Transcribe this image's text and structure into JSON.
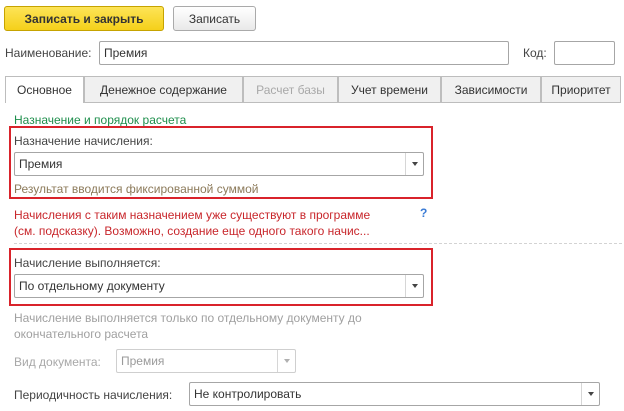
{
  "toolbar": {
    "write_close_label": "Записать и закрыть",
    "write_label": "Записать"
  },
  "header": {
    "name_label": "Наименование:",
    "name_value": "Премия",
    "code_label": "Код:",
    "code_value": ""
  },
  "tabs": [
    {
      "label": "Основное"
    },
    {
      "label": "Денежное содержание"
    },
    {
      "label": "Расчет базы"
    },
    {
      "label": "Учет времени"
    },
    {
      "label": "Зависимости"
    },
    {
      "label": "Приоритет"
    }
  ],
  "main": {
    "section_title": "Назначение и порядок расчета",
    "purpose_label": "Назначение начисления:",
    "purpose_value": "Премия",
    "purpose_hint": "Результат вводится фиксированной суммой",
    "warning_line1": "Начисления с таким назначением уже существуют в программе",
    "warning_line2": "(см. подсказку). Возможно, создание еще одного такого начис...",
    "help_glyph": "?",
    "execution_label": "Начисление выполняется:",
    "execution_value": "По отдельному документу",
    "execution_hint_line1": "Начисление выполняется только по отдельному документу до",
    "execution_hint_line2": "окончательного расчета",
    "doc_type_label": "Вид документа:",
    "doc_type_value": "Премия",
    "periodicity_label": "Периодичность начисления:",
    "periodicity_value": "Не контролировать"
  },
  "colors": {
    "accent_yellow": "#f5d01a",
    "section_green": "#1e8f4c",
    "warning_red": "#c8262b",
    "highlight_red": "#d9232b",
    "hint_brown": "#8c7a5a",
    "help_blue": "#3a7bd5"
  }
}
